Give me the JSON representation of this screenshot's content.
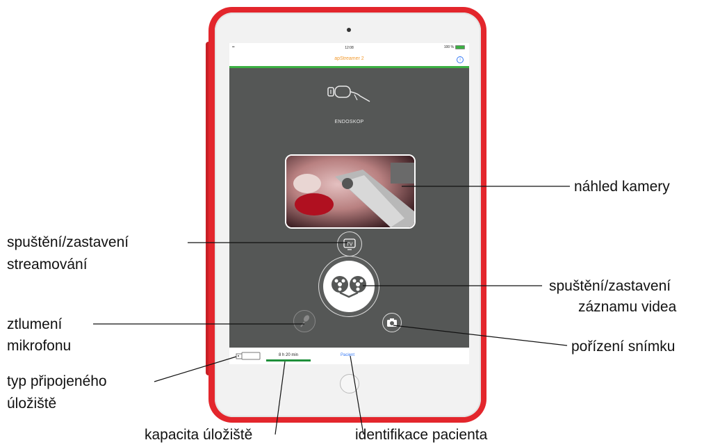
{
  "app": {
    "status_time": "12:08",
    "battery": "100 %",
    "title": "apStreamer 2",
    "info_glyph": "i",
    "device_label": "ENDOSKOP",
    "stream_button_glyph": "TV",
    "capacity": "8 h 20 min",
    "patient_link": "Pacient",
    "accent_color": "#f29a2e",
    "link_color": "#3478f6",
    "progress_color": "#3cb043"
  },
  "callouts": {
    "camera_preview": "náhled kamery",
    "stream_toggle_line1": "spuštění/zastavení",
    "stream_toggle_line2": "streamování",
    "record_toggle_line1": "spuštění/zastavení",
    "record_toggle_line2": "záznamu videa",
    "mute_mic_line1": "ztlumení",
    "mute_mic_line2": "mikrofonu",
    "snapshot": "pořízení snímku",
    "storage_type_line1": "typ připojeného",
    "storage_type_line2": "úložiště",
    "storage_capacity": "kapacita úložiště",
    "patient_id": "identifikace pacienta"
  }
}
